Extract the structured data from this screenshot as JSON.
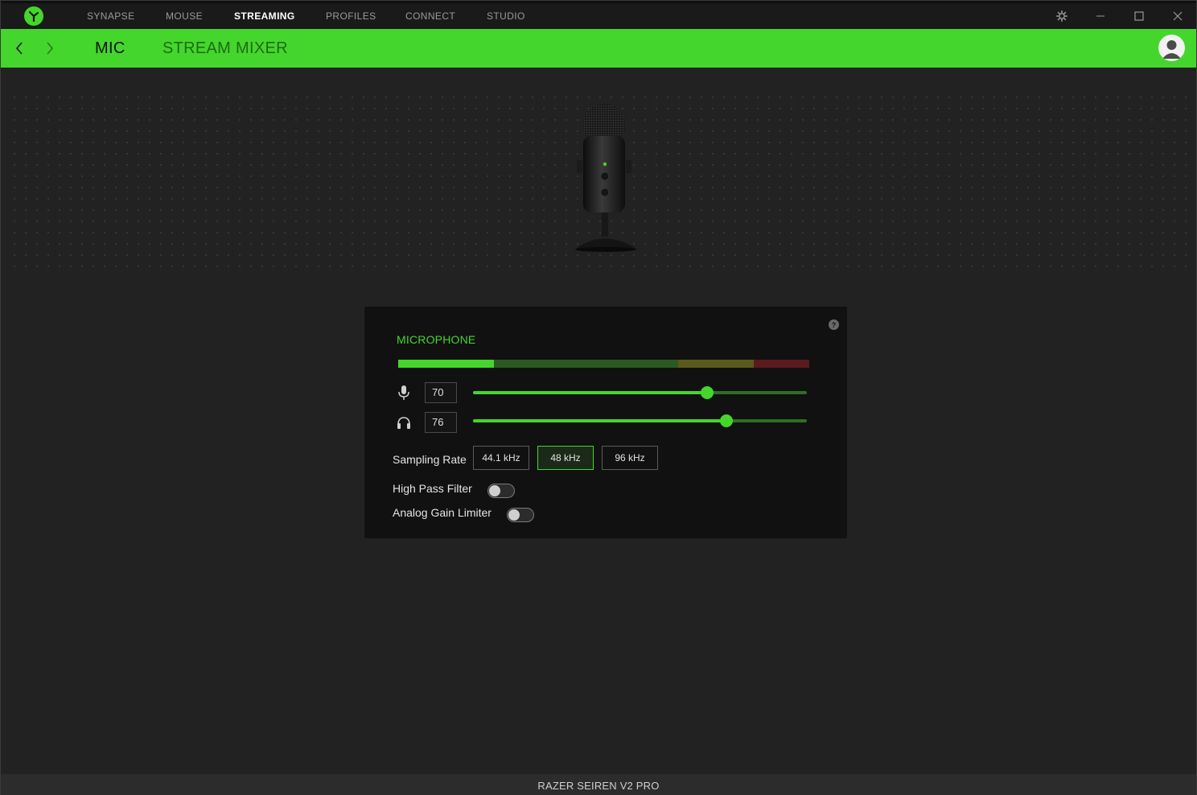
{
  "top_nav": {
    "tabs": [
      {
        "label": "SYNAPSE"
      },
      {
        "label": "MOUSE"
      },
      {
        "label": "STREAMING"
      },
      {
        "label": "PROFILES"
      },
      {
        "label": "CONNECT"
      },
      {
        "label": "STUDIO"
      }
    ],
    "active_tab": "STREAMING",
    "icons": [
      "razer-logo-icon",
      "settings-gear-icon",
      "minimize-icon",
      "maximize-icon",
      "close-icon"
    ]
  },
  "sub_nav": {
    "tabs": [
      {
        "label": "MIC"
      },
      {
        "label": "STREAM MIXER"
      }
    ],
    "active_tab": "MIC"
  },
  "microphone_panel": {
    "title": "MICROPHONE",
    "help_glyph": "?",
    "mic_gain": {
      "value": "70",
      "level": 70
    },
    "monitor_volume": {
      "value": "76",
      "level": 76
    },
    "sampling_rate": {
      "label": "Sampling Rate",
      "options": [
        "44.1 kHz",
        "48 kHz",
        "96 kHz"
      ],
      "selected": "48 kHz"
    },
    "high_pass_filter": {
      "label": "High Pass Filter",
      "enabled": false
    },
    "analog_gain_limiter": {
      "label": "Analog Gain Limiter",
      "enabled": false
    }
  },
  "footer": {
    "device_name": "RAZER SEIREN V2 PRO"
  },
  "colors": {
    "accent": "#44d62c",
    "background": "#222222",
    "panel": "#111111"
  }
}
